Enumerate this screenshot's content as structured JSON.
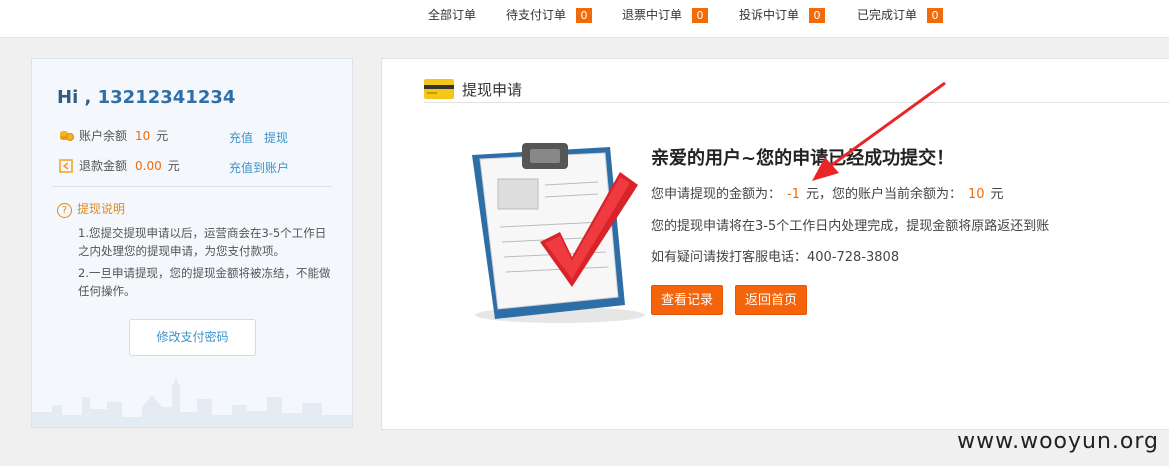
{
  "tabs": [
    {
      "label": "全部订单",
      "count": null
    },
    {
      "label": "待支付订单",
      "count": "0"
    },
    {
      "label": "退票中订单",
      "count": "0"
    },
    {
      "label": "投诉中订单",
      "count": "0"
    },
    {
      "label": "已完成订单",
      "count": "0"
    }
  ],
  "user": {
    "greeting": "Hi ,",
    "phone": "13212341234",
    "balance_label": "账户余额",
    "balance_value": "10",
    "refund_label": "退款金额",
    "refund_value": "0.00",
    "unit": "元",
    "recharge_link": "充值",
    "withdraw_link": "提现",
    "recharge_to_account_link": "充值到账户",
    "tips_title": "提现说明",
    "tip1": "1.您提交提现申请以后，运营商会在3-5个工作日之内处理您的提现申请，为您支付款项。",
    "tip2": "2.一旦申请提现，您的提现金额将被冻结，不能做任何操作。",
    "change_pwd_button": "修改支付密码"
  },
  "main": {
    "section_title": "提现申请",
    "success_heading": "亲爱的用户~您的申请已经成功提交！",
    "amount_prefix": "您申请提现的金额为：",
    "amount_value": "-1",
    "amount_mid": "元，您的账户当前余额为：",
    "balance_value": "10",
    "amount_suffix": "元",
    "process_note": "您的提现申请将在3-5个工作日内处理完成，提现金额将原路返还到账",
    "phone_note": "如有疑问请拨打客服电话：400-728-3808",
    "records_button": "查看记录",
    "home_button": "返回首页"
  },
  "watermark": "www.wooyun.org",
  "colors": {
    "accent": "#f5630a",
    "link": "#3b94cf",
    "annotation_arrow": "#e8262a"
  }
}
